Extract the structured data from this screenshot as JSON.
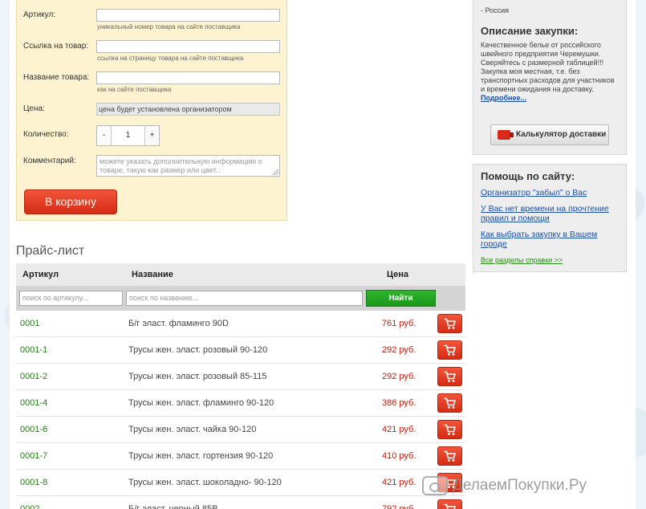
{
  "form": {
    "sku_label": "Артикул:",
    "sku_hint": "уникальный номер товара на сайте поставщика",
    "link_label": "Ссылка на товар:",
    "link_hint": "ссылка на страницу товара на сайте поставщика",
    "name_label": "Название товара:",
    "name_hint": "как на сайте поставщика",
    "price_label": "Цена:",
    "price_value": "цена будет установлена организатором",
    "qty_label": "Количество:",
    "qty_minus": "-",
    "qty_value": "1",
    "qty_plus": "+",
    "comment_label": "Комментарий:",
    "comment_placeholder": "можете указать дополнительную информацию о товаре, такую как размер или цвет...",
    "cart_button": "В корзину"
  },
  "price_list": {
    "title": "Прайс-лист",
    "col_sku": "Артикул",
    "col_name": "Название",
    "col_price": "Цена",
    "filter_sku_placeholder": "поиск по артикулу...",
    "filter_name_placeholder": "поиск по названию...",
    "find_button": "Найти",
    "rows": [
      {
        "sku": "0001",
        "name": "Б/г эласт. фламинго 90D",
        "price": "761 руб."
      },
      {
        "sku": "0001-1",
        "name": "Трусы жен. эласт. розовый 90-120",
        "price": "292 руб."
      },
      {
        "sku": "0001-2",
        "name": "Трусы жен. эласт. розовый 85-115",
        "price": "292 руб."
      },
      {
        "sku": "0001-4",
        "name": "Трусы жен. эласт. фламинго 90-120",
        "price": "386 руб."
      },
      {
        "sku": "0001-6",
        "name": "Трусы жен. эласт. чайка 90-120",
        "price": "421 руб."
      },
      {
        "sku": "0001-7",
        "name": "Трусы жен. эласт. гортензия 90-120",
        "price": "410 руб."
      },
      {
        "sku": "0001-8",
        "name": "Трусы жен. эласт. шоколадно- 90-120",
        "price": "421 руб."
      },
      {
        "sku": "0002",
        "name": "Б/г эласт. черный 85B",
        "price": "792 руб."
      }
    ]
  },
  "sidebar": {
    "country": "- Россия",
    "desc_title": "Описание закупки:",
    "desc_text": "Качественное белье от российского швейного предприятия Черемушки. Сверяйтесь с размерной таблицей!!! Закупка моя местная, т.е. без транспортных расходов для участников и времени ожидания на доставку.",
    "more_link": "Подробнее...",
    "calc_button": "Калькулятор доставки",
    "help_title": "Помощь по сайту:",
    "help_links": [
      "Организатор \"забыл\" о Вас",
      "У Вас нет времени на прочтение правил и помощи",
      "Как выбрать закупку в Вашем городе"
    ],
    "help_all": "Все разделы справки >>"
  },
  "watermark": {
    "text": "ДелаемПокупки.Ру"
  }
}
